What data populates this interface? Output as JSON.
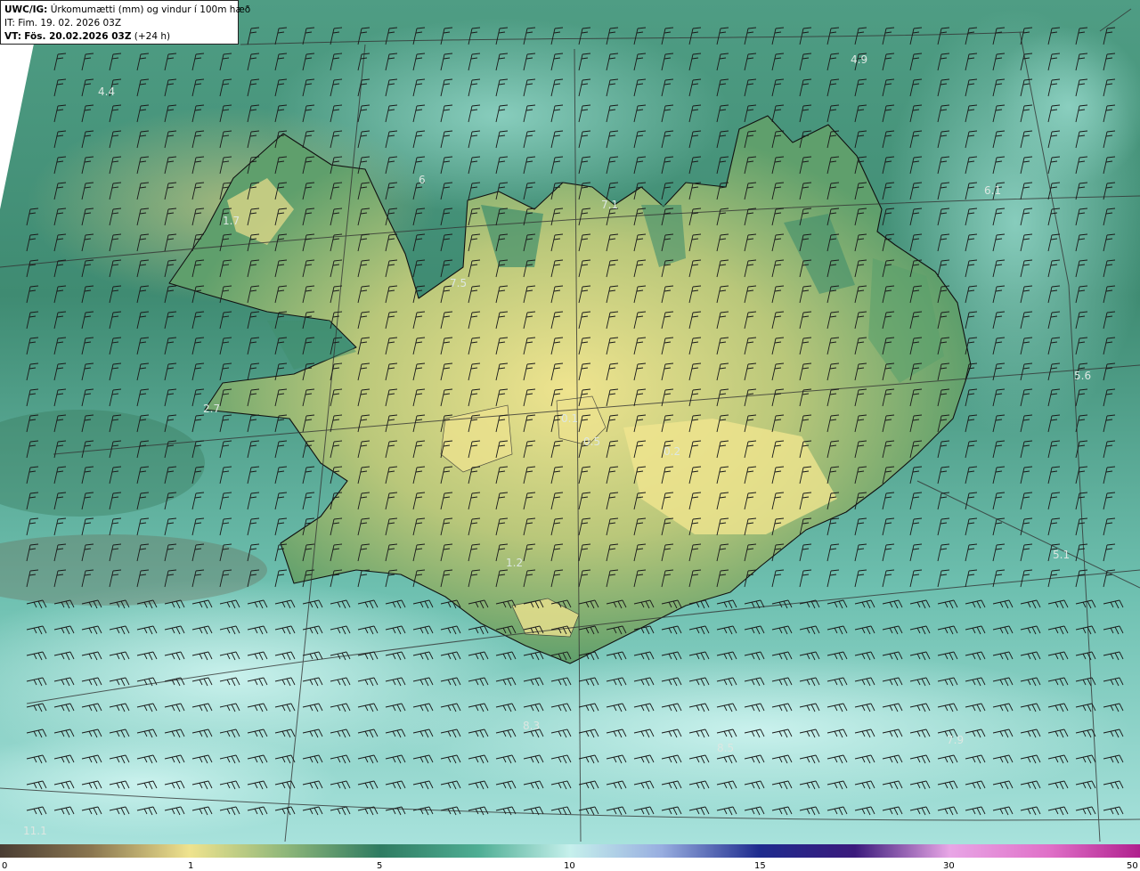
{
  "header": {
    "model": "UWC/IG:",
    "parameter": "Úrkomumætti (mm) og vindur í 100m hæð",
    "initial_label": "IT:",
    "initial_time": "Fim. 19. 02. 2026 03Z",
    "valid_label": "VT:",
    "valid_time": "Fös. 20.02.2026 03Z",
    "lead": "(+24 h)"
  },
  "value_labels": [
    {
      "text": "4.4"
    },
    {
      "text": "4.9"
    },
    {
      "text": "6.1"
    },
    {
      "text": "5.6"
    },
    {
      "text": "5.1"
    },
    {
      "text": "1.7"
    },
    {
      "text": "2.7"
    },
    {
      "text": "6"
    },
    {
      "text": "7.1"
    },
    {
      "text": "7.5"
    },
    {
      "text": "0.1"
    },
    {
      "text": "0.5"
    },
    {
      "text": "0.2"
    },
    {
      "text": "1.2"
    },
    {
      "text": "8.3"
    },
    {
      "text": "8.5"
    },
    {
      "text": "7.9"
    },
    {
      "text": "11.1"
    }
  ],
  "colorbar": {
    "tick_labels": [
      "0",
      "1",
      "5",
      "10",
      "15",
      "30",
      "50"
    ],
    "colors": [
      "#5d4a37",
      "#8c7752",
      "#c8b873",
      "#efe38e",
      "#b6c77d",
      "#6da470",
      "#2f7b61",
      "#3e9b83",
      "#7fcfc0",
      "#c6f0ec",
      "#b8cce8",
      "#6f7fc6",
      "#1e2b8e",
      "#2a0e6e",
      "#7d3c9a",
      "#d47bd0",
      "#f2a8e2",
      "#c02a9c"
    ]
  },
  "colors": {
    "ocean_south": "#a9e3dc",
    "ocean_north": "#4d9d86",
    "land_low": "#3f8e6c",
    "land_high": "#e3df8f",
    "coastline": "#111111",
    "grid": "#333333"
  }
}
